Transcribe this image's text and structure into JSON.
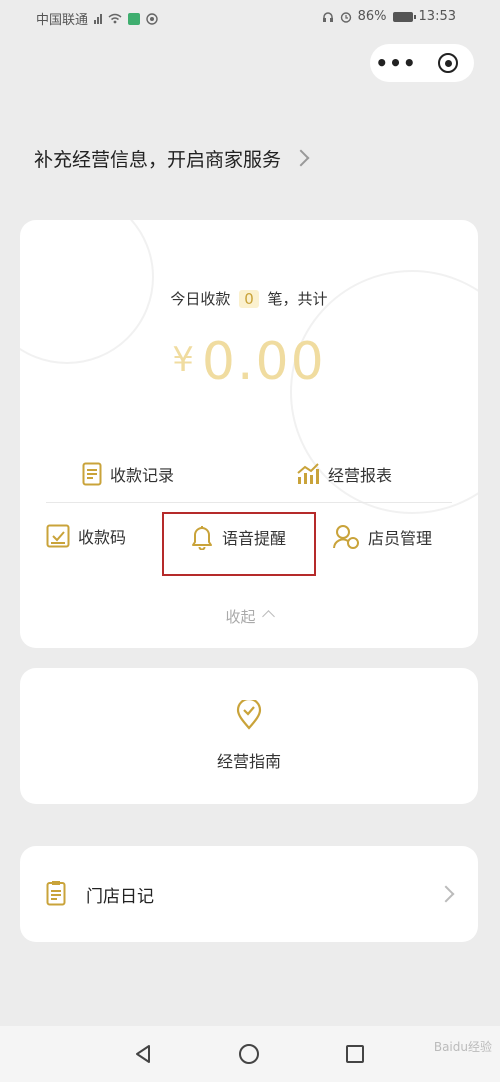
{
  "status_bar": {
    "carrier": "中国联通",
    "battery": "86%",
    "time": "13:53"
  },
  "capsule": {
    "more_icon": "more-dots-icon",
    "close_icon": "target-close-icon"
  },
  "banner": {
    "text": "补充经营信息，开启商家服务"
  },
  "summary": {
    "prefix": "今日收款",
    "count": "0",
    "suffix": "笔，共计",
    "currency": "¥",
    "amount": "0.00"
  },
  "menu": {
    "records": "收款记录",
    "reports": "经营报表",
    "qrcode": "收款码",
    "voice": "语音提醒",
    "staff": "店员管理",
    "collapse": "收起"
  },
  "guide": {
    "label": "经营指南"
  },
  "diary": {
    "label": "门店日记"
  },
  "watermark": "Baidu经验",
  "colors": {
    "accent": "#c9a33a",
    "amount": "#f0dca0",
    "highlight": "#b52a2a",
    "background": "#ececec"
  }
}
